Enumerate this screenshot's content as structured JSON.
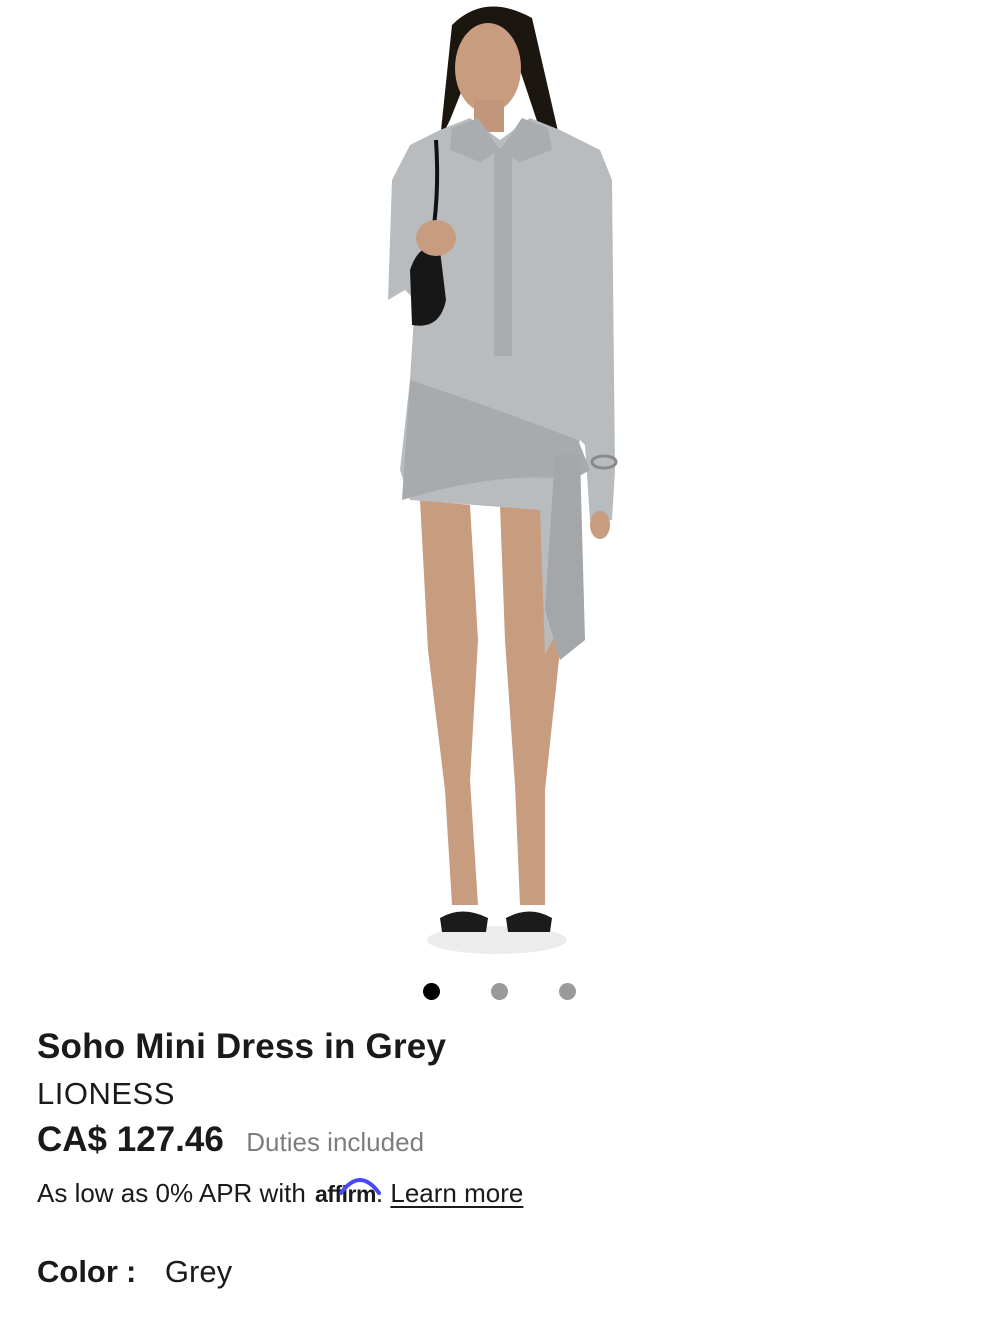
{
  "product": {
    "title": "Soho Mini Dress in Grey",
    "brand": "LIONESS",
    "price": "CA$ 127.46",
    "duties_note": "Duties included"
  },
  "financing": {
    "prefix": "As low as 0% APR with",
    "provider": "affirm",
    "suffix": ".",
    "link_label": "Learn more"
  },
  "color": {
    "label": "Color",
    "separator": ":",
    "value": "Grey"
  },
  "gallery": {
    "image_count": 3,
    "active_index": 0
  },
  "colors": {
    "text": "#1a1a1a",
    "muted": "#7d7d7d",
    "dot_active": "#000000",
    "dot_inactive": "#9a9a9a",
    "affirm_arc": "#4a4af4",
    "dress": "#b8bcbe"
  }
}
